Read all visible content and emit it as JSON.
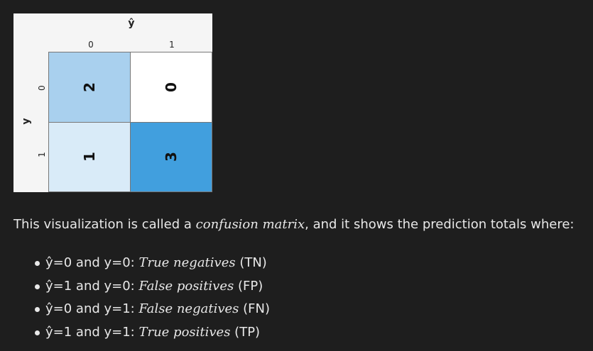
{
  "figure": {
    "x_axis_title": "ŷ",
    "y_axis_title": "y",
    "col_ticks": [
      "0",
      "1"
    ],
    "row_ticks": [
      "0",
      "1"
    ],
    "colors": {
      "tn": "#a9d0ee",
      "fp": "#ffffff",
      "fn": "#d9ebf8",
      "tp": "#419fde"
    }
  },
  "chart_data": {
    "type": "heatmap",
    "x_axis_title": "ŷ",
    "y_axis_title": "y",
    "x_categories": [
      "0",
      "1"
    ],
    "y_categories": [
      "0",
      "1"
    ],
    "values": [
      [
        2,
        0
      ],
      [
        1,
        3
      ]
    ],
    "cell_labels": [
      [
        "2",
        "0"
      ],
      [
        "1",
        "3"
      ]
    ]
  },
  "text": {
    "intro_prefix": "This visualization is called a ",
    "intro_term": "confusion matrix",
    "intro_suffix": ", and it shows the prediction totals where:",
    "items": [
      {
        "condition": "ŷ=0 and y=0: ",
        "term": "True negatives",
        "abbr": " (TN)"
      },
      {
        "condition": "ŷ=1 and y=0: ",
        "term": "False positives",
        "abbr": " (FP)"
      },
      {
        "condition": "ŷ=0 and y=1: ",
        "term": "False negatives",
        "abbr": " (FN)"
      },
      {
        "condition": "ŷ=1 and y=1: ",
        "term": "True positives",
        "abbr": " (TP)"
      }
    ]
  }
}
